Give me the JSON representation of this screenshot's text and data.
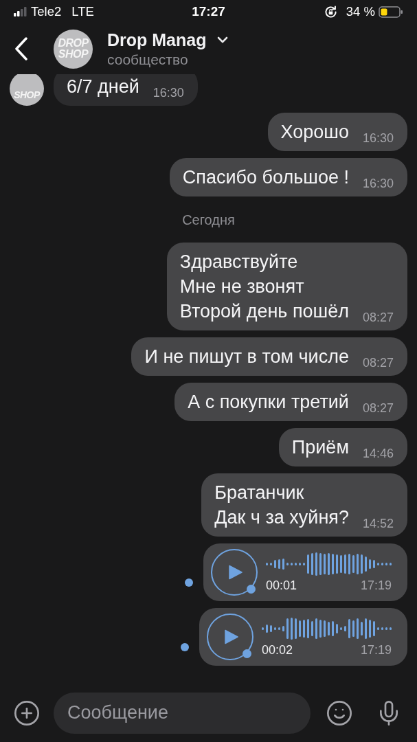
{
  "status_bar": {
    "carrier": "Tele2",
    "network": "LTE",
    "time": "17:27",
    "battery": "34 %"
  },
  "header": {
    "title": "Drop Manag",
    "subtitle": "сообщество",
    "avatar_logo": [
      "DROP",
      "SHOP"
    ]
  },
  "messages": [
    {
      "kind": "text",
      "outgoing": false,
      "text": "6/7 дней",
      "time": "16:30",
      "avatar_logo": [
        "SHOP"
      ]
    },
    {
      "kind": "text",
      "outgoing": true,
      "text": "Хорошо",
      "time": "16:30"
    },
    {
      "kind": "text",
      "outgoing": true,
      "text": "Спасибо большое !",
      "time": "16:30"
    },
    {
      "kind": "date",
      "text": "Сегодня"
    },
    {
      "kind": "text",
      "outgoing": true,
      "text": "Здравствуйте\nМне не звонят\nВторой день пошёл",
      "time": "08:27"
    },
    {
      "kind": "text",
      "outgoing": true,
      "text": "И не пишут в том числе",
      "time": "08:27"
    },
    {
      "kind": "text",
      "outgoing": true,
      "text": "А с покупки третий",
      "time": "08:27"
    },
    {
      "kind": "text",
      "outgoing": true,
      "text": "Приём",
      "time": "14:46"
    },
    {
      "kind": "text",
      "outgoing": true,
      "text": "Братанчик\nДак ч за хуйня?",
      "time": "14:52"
    },
    {
      "kind": "voice",
      "outgoing": true,
      "duration": "00:01",
      "time": "17:19",
      "unread": true
    },
    {
      "kind": "voice",
      "outgoing": true,
      "duration": "00:02",
      "time": "17:19",
      "unread": true
    }
  ],
  "composer": {
    "placeholder": "Сообщение"
  }
}
